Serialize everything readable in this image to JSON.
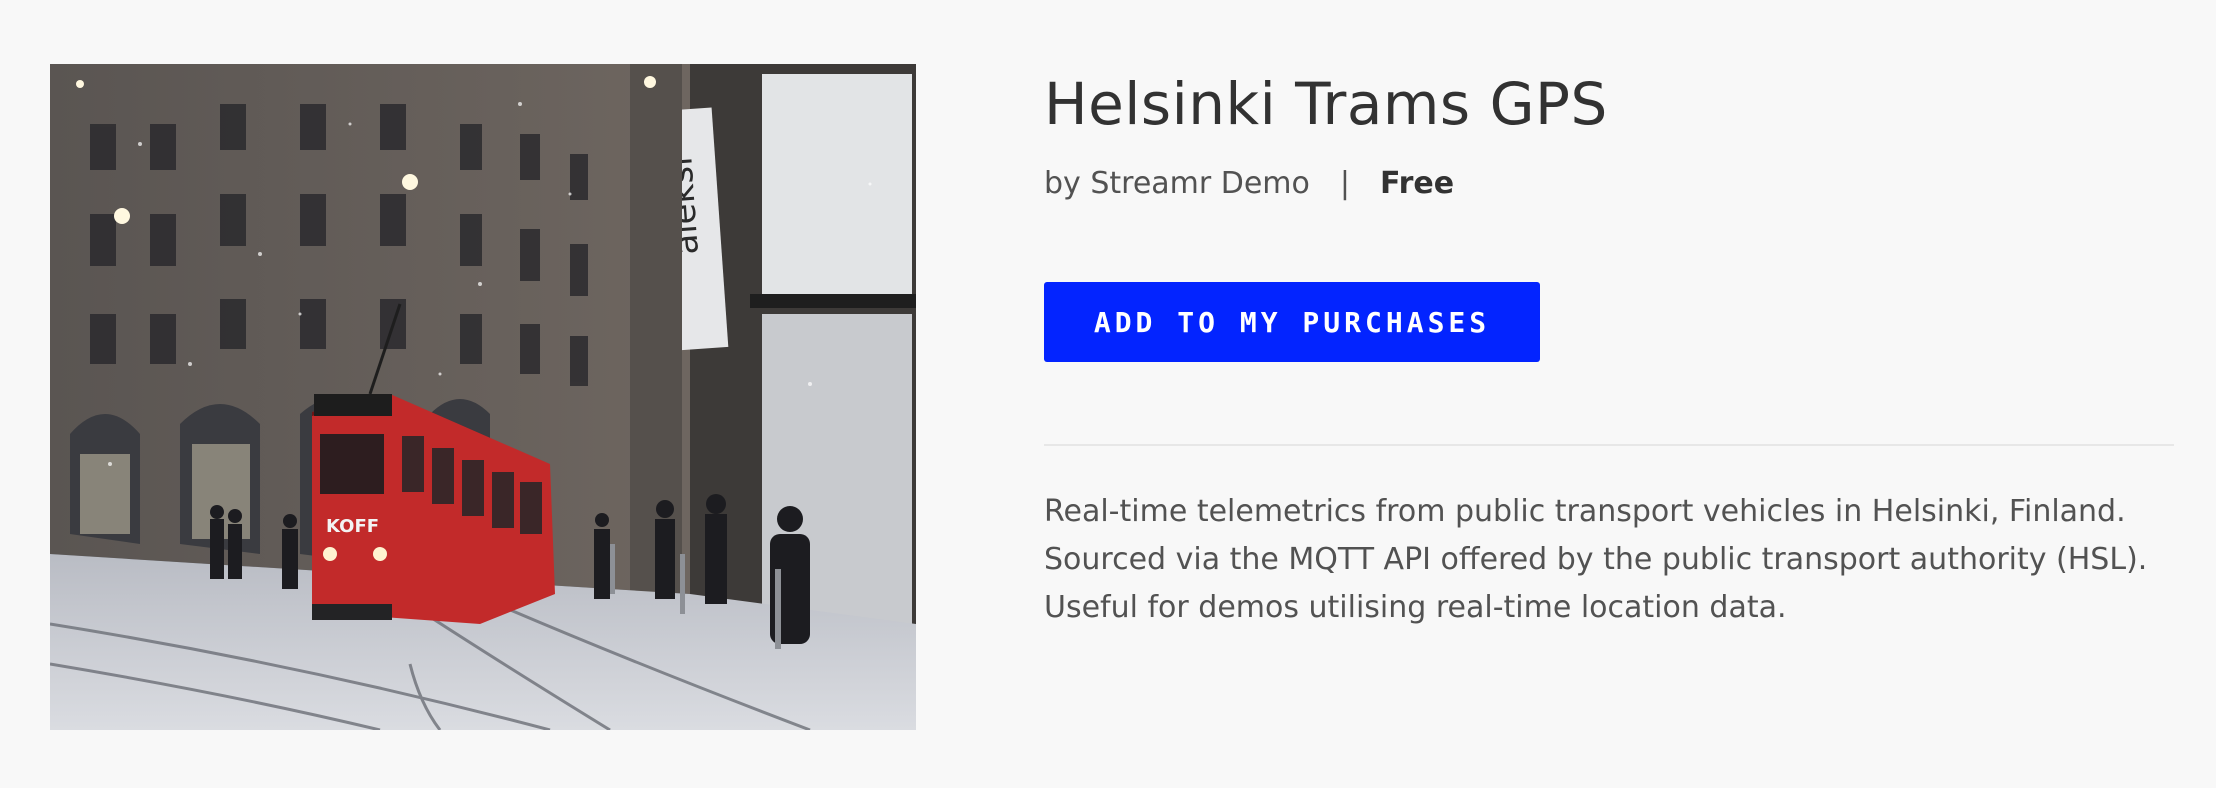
{
  "product": {
    "title": "Helsinki Trams GPS",
    "by_label": "by Streamr Demo",
    "separator": "|",
    "price": "Free",
    "cta_label": "ADD TO MY PURCHASES",
    "description_lines": [
      "Real-time telemetrics from public transport vehicles in Helsinki, Finland.",
      "Sourced via the MQTT API offered by the public transport authority (HSL).",
      "Useful for demos utilising real-time location data."
    ]
  },
  "image": {
    "subject": "red tram on snowy Helsinki street",
    "sign_text": "aleksi",
    "tram_text": "KOFF"
  },
  "colors": {
    "background": "#f8f8f8",
    "accent": "#0324ff",
    "title": "#323232",
    "text": "#525252"
  }
}
